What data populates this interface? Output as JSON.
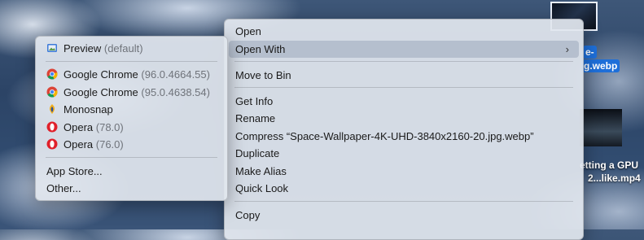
{
  "main_menu": {
    "items": [
      {
        "label": "Open"
      },
      {
        "label": "Open With"
      },
      {
        "label": "Move to Bin"
      },
      {
        "label": "Get Info"
      },
      {
        "label": "Rename"
      },
      {
        "label": "Compress “Space-Wallpaper-4K-UHD-3840x2160-20.jpg.webp”"
      },
      {
        "label": "Duplicate"
      },
      {
        "label": "Make Alias"
      },
      {
        "label": "Quick Look"
      },
      {
        "label": "Copy"
      }
    ]
  },
  "submenu": {
    "apps": [
      {
        "name": "Preview",
        "detail": "(default)",
        "icon": "preview-icon"
      },
      {
        "name": "Google Chrome",
        "detail": "(96.0.4664.55)",
        "icon": "chrome-icon"
      },
      {
        "name": "Google Chrome",
        "detail": "(95.0.4638.54)",
        "icon": "chrome-icon"
      },
      {
        "name": "Monosnap",
        "detail": "",
        "icon": "monosnap-icon"
      },
      {
        "name": "Opera",
        "detail": "(78.0)",
        "icon": "opera-icon"
      },
      {
        "name": "Opera",
        "detail": "(76.0)",
        "icon": "opera-icon"
      }
    ],
    "app_store": "App Store...",
    "other": "Other..."
  },
  "desktop": {
    "selected_file_label_line1": "e-",
    "selected_file_label_line2": "g.webp",
    "video_label_line1": "etting a GPU",
    "video_label_line2": "2...like.mp4"
  },
  "colors": {
    "selection_blue": "#1e6fd9",
    "highlight": "#a0acbe"
  }
}
